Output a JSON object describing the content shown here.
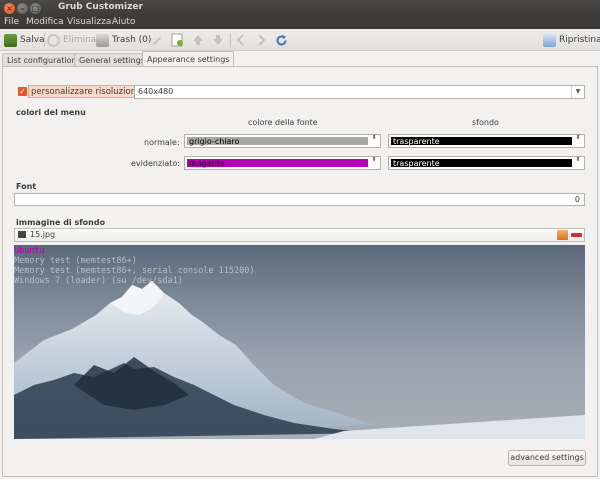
{
  "window": {
    "title": "Grub Customizer",
    "close_glyph": "×",
    "min_glyph": "–",
    "max_glyph": "□"
  },
  "menu": [
    "File",
    "Modifica",
    "Visualizza",
    "Aiuto"
  ],
  "toolbar": {
    "save": "Salva",
    "delete": "Elimina",
    "trash": "Trash (0)",
    "restore": "Ripristina"
  },
  "tabs": [
    "List configuration",
    "General settings",
    "Appearance settings"
  ],
  "resolution": {
    "checkbox_glyph": "✓",
    "label": "personalizzare risoluzione:",
    "value": "640x480",
    "arrow": "▼"
  },
  "menu_colors": {
    "heading": "colori del menu",
    "font_color_header": "colore della fonte",
    "background_header": "sfondo",
    "normal_label": "normale:",
    "highlight_label": "evidenziato:",
    "spin_glyph": "⬍",
    "normal_font": {
      "name": "grigio-chiaro",
      "color": "#a8a8a8"
    },
    "normal_bg": {
      "name": "trasparente",
      "color": "#000000"
    },
    "highlight_font": {
      "name": "magenta",
      "color": "#b400b4"
    },
    "highlight_bg": {
      "name": "trasparente",
      "color": "#000000"
    }
  },
  "font": {
    "heading": "Font",
    "value": "0"
  },
  "background_image": {
    "heading": "immagine di sfondo",
    "file": "15.jpg"
  },
  "preview": {
    "entries": [
      "Ubuntu",
      "Memory test (memtest86+)",
      "Memory test (memtest86+, serial console 115200)",
      "Windows 7 (loader) (su /dev/sda1)"
    ],
    "highlight_color": "#b400b4",
    "normal_color": "#b9bfc6"
  },
  "advanced_button": "advanced settings",
  "colors": {
    "accent": "#e4572e",
    "titlebar": "#3c3b37"
  }
}
